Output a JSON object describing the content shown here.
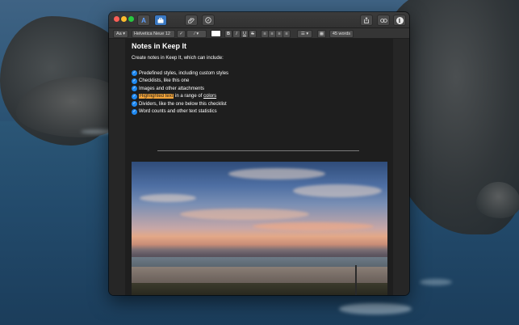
{
  "window": {
    "format_bar": {
      "style_menu": "Aa",
      "font_name": "Helvetica Neue 12",
      "bold": "B",
      "italic": "I",
      "underline": "U",
      "strikethrough": "S",
      "word_count": "45 words"
    }
  },
  "note": {
    "title": "Notes in Keep It",
    "intro": "Create notes in Keep It, which can include:",
    "checklist": [
      "Predefined styles, including custom styles",
      "Checklists, like this one",
      "Images and other attachments",
      "Dividers, like the one below this checklist",
      "Word counts and other text statistics"
    ],
    "highlight_item": {
      "highlighted": "Highlighted text",
      "middle": " in a range of ",
      "underlined": "colors"
    },
    "colors": {
      "check": "#1e88f0",
      "highlight": "#f2a43a"
    }
  }
}
